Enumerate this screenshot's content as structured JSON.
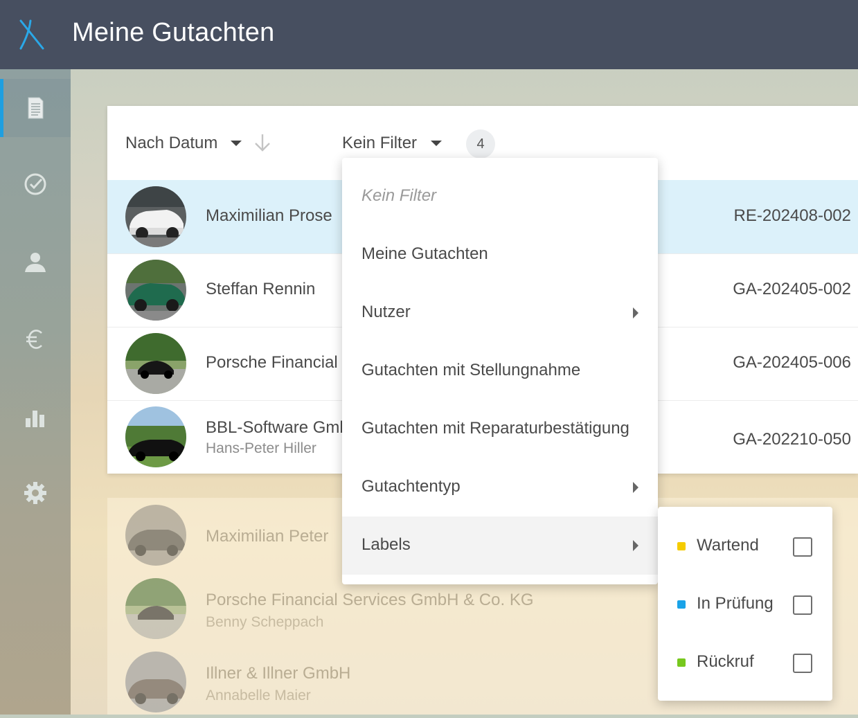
{
  "header": {
    "title": "Meine Gutachten",
    "logo_icon": "x-logo-icon"
  },
  "colors": {
    "topbar": "#474f60",
    "accent": "#1f9fe0",
    "selected_row": "#dcf1fa"
  },
  "sidebar": {
    "items": [
      {
        "icon": "document-icon",
        "active": true
      },
      {
        "icon": "checkmark-circle-icon",
        "active": false
      },
      {
        "icon": "user-icon",
        "active": false
      },
      {
        "icon": "euro-icon",
        "active": false
      },
      {
        "icon": "bar-chart-icon",
        "active": false
      },
      {
        "icon": "gear-icon",
        "active": false
      }
    ]
  },
  "toolbar": {
    "sort_label": "Nach Datum",
    "filter_label": "Kein Filter",
    "count": "4"
  },
  "rows": [
    {
      "name": "Maximilian Prose",
      "sub": "",
      "code": "RE-202408-002",
      "selected": true
    },
    {
      "name": "Steffan Rennin",
      "sub": "",
      "code": "GA-202405-002",
      "selected": false
    },
    {
      "name": "Porsche Financial",
      "sub": "",
      "code": "GA-202405-006",
      "selected": false
    },
    {
      "name": "BBL-Software Gmb",
      "sub": "Hans-Peter Hiller",
      "code": "GA-202210-050",
      "selected": false
    }
  ],
  "faded_rows": [
    {
      "name": "Maximilian Peter",
      "sub": ""
    },
    {
      "name": "Porsche Financial Services GmbH & Co. KG",
      "sub": "Benny Scheppach"
    },
    {
      "name": "Illner & Illner GmbH",
      "sub": "Annabelle Maier"
    }
  ],
  "filter_menu": {
    "items": [
      {
        "label": "Kein Filter",
        "has_submenu": false
      },
      {
        "label": "Meine Gutachten",
        "has_submenu": false
      },
      {
        "label": "Nutzer",
        "has_submenu": true
      },
      {
        "label": "Gutachten mit Stellungnahme",
        "has_submenu": false
      },
      {
        "label": "Gutachten mit Reparaturbestätigung",
        "has_submenu": false
      },
      {
        "label": "Gutachtentyp",
        "has_submenu": true
      },
      {
        "label": "Labels",
        "has_submenu": true
      }
    ]
  },
  "labels_submenu": {
    "items": [
      {
        "label": "Wartend",
        "color": "#f5cc00",
        "checked": false
      },
      {
        "label": "In Prüfung",
        "color": "#1aa3e8",
        "checked": false
      },
      {
        "label": "Rückruf",
        "color": "#77c81e",
        "checked": false
      }
    ]
  }
}
